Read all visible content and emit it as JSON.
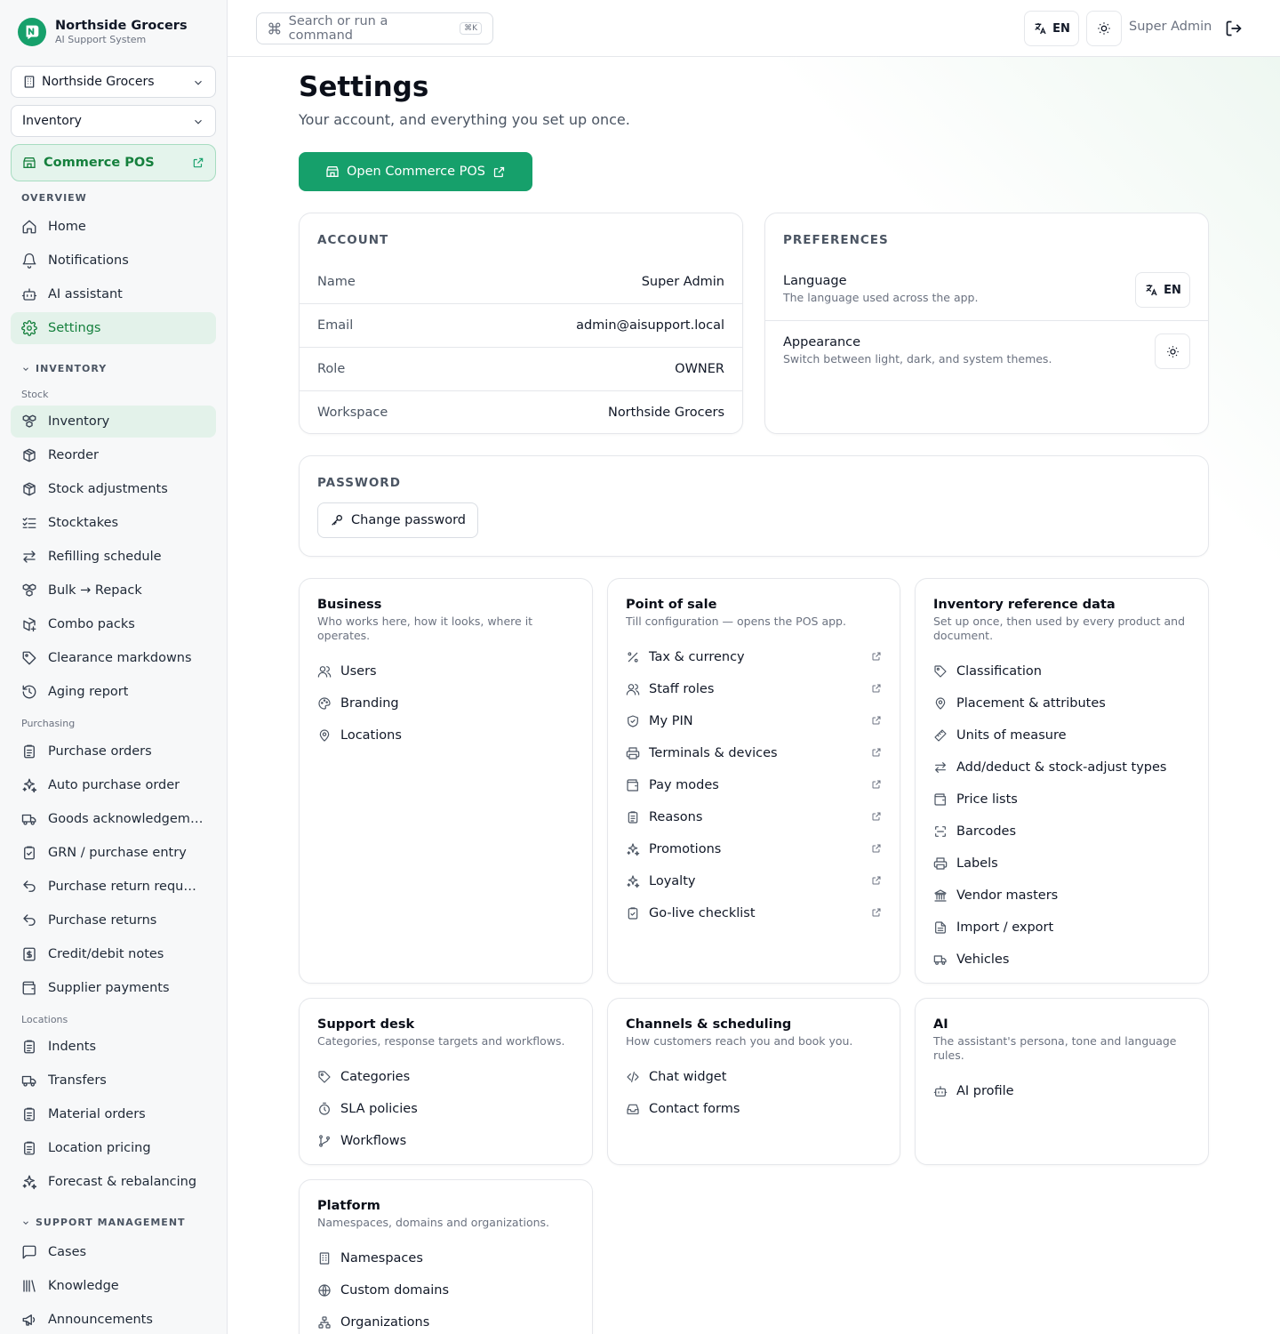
{
  "brand": {
    "name": "Northside Grocers",
    "subtitle": "AI Support System"
  },
  "sidebar": {
    "workspace_select": "Northside Grocers",
    "module_select": "Inventory",
    "pos_button": "Commerce POS",
    "overview_title": "OVERVIEW",
    "overview": [
      {
        "label": "Home",
        "icon": "home-icon"
      },
      {
        "label": "Notifications",
        "icon": "bell-icon"
      },
      {
        "label": "AI assistant",
        "icon": "bot-icon"
      },
      {
        "label": "Settings",
        "icon": "gear-icon",
        "active": true
      }
    ],
    "inventory_title": "INVENTORY",
    "stock_label": "Stock",
    "stock": [
      {
        "label": "Inventory",
        "icon": "boxes-icon",
        "active": true
      },
      {
        "label": "Reorder",
        "icon": "package-icon"
      },
      {
        "label": "Stock adjustments",
        "icon": "package-icon"
      },
      {
        "label": "Stocktakes",
        "icon": "list-check-icon"
      },
      {
        "label": "Refilling schedule",
        "icon": "arrows-icon"
      },
      {
        "label": "Bulk → Repack",
        "icon": "boxes-icon"
      },
      {
        "label": "Combo packs",
        "icon": "package-plus-icon"
      },
      {
        "label": "Clearance markdowns",
        "icon": "tag-icon"
      },
      {
        "label": "Aging report",
        "icon": "history-icon"
      }
    ],
    "purchasing_label": "Purchasing",
    "purchasing": [
      {
        "label": "Purchase orders",
        "icon": "clipboard-icon"
      },
      {
        "label": "Auto purchase order",
        "icon": "sparkles-icon"
      },
      {
        "label": "Goods acknowledgement",
        "icon": "truck-icon"
      },
      {
        "label": "GRN / purchase entry",
        "icon": "clipboard-check-icon"
      },
      {
        "label": "Purchase return requests",
        "icon": "undo-icon"
      },
      {
        "label": "Purchase returns",
        "icon": "undo-icon"
      },
      {
        "label": "Credit/debit notes",
        "icon": "receipt-icon"
      },
      {
        "label": "Supplier payments",
        "icon": "wallet-icon"
      }
    ],
    "locations_label": "Locations",
    "locations": [
      {
        "label": "Indents",
        "icon": "clipboard-icon"
      },
      {
        "label": "Transfers",
        "icon": "truck-icon"
      },
      {
        "label": "Material orders",
        "icon": "clipboard-icon"
      },
      {
        "label": "Location pricing",
        "icon": "clipboard-icon"
      },
      {
        "label": "Forecast & rebalancing",
        "icon": "sparkles-icon"
      }
    ],
    "support_title": "SUPPORT MANAGEMENT",
    "support": [
      {
        "label": "Cases",
        "icon": "message-square-icon"
      },
      {
        "label": "Knowledge",
        "icon": "library-icon"
      },
      {
        "label": "Announcements",
        "icon": "megaphone-icon"
      }
    ]
  },
  "topbar": {
    "search_placeholder": "Search or run a command",
    "search_kbd": "⌘K",
    "lang": "EN",
    "user": "Super Admin"
  },
  "main": {
    "title": "Settings",
    "subtitle": "Your account, and everything you set up once.",
    "open_pos": "Open Commerce POS",
    "account": {
      "title": "ACCOUNT",
      "rows": [
        {
          "k": "Name",
          "v": "Super Admin"
        },
        {
          "k": "Email",
          "v": "admin@aisupport.local"
        },
        {
          "k": "Role",
          "v": "OWNER"
        },
        {
          "k": "Workspace",
          "v": "Northside Grocers"
        }
      ]
    },
    "preferences": {
      "title": "PREFERENCES",
      "language": {
        "t": "Language",
        "d": "The language used across the app.",
        "btn": "EN"
      },
      "appearance": {
        "t": "Appearance",
        "d": "Switch between light, dark, and system themes."
      }
    },
    "password": {
      "title": "PASSWORD",
      "btn": "Change password"
    },
    "groups": {
      "business": {
        "title": "Business",
        "desc": "Who works here, how it looks, where it operates.",
        "items": [
          {
            "label": "Users",
            "icon": "users-icon"
          },
          {
            "label": "Branding",
            "icon": "palette-icon"
          },
          {
            "label": "Locations",
            "icon": "map-pin-icon"
          }
        ]
      },
      "pos": {
        "title": "Point of sale",
        "desc": "Till configuration — opens the POS app.",
        "items": [
          {
            "label": "Tax & currency",
            "icon": "percent-icon"
          },
          {
            "label": "Staff roles",
            "icon": "users-icon"
          },
          {
            "label": "My PIN",
            "icon": "shield-icon"
          },
          {
            "label": "Terminals & devices",
            "icon": "printer-icon"
          },
          {
            "label": "Pay modes",
            "icon": "wallet-icon"
          },
          {
            "label": "Reasons",
            "icon": "clipboard-icon"
          },
          {
            "label": "Promotions",
            "icon": "sparkles-icon"
          },
          {
            "label": "Loyalty",
            "icon": "sparkles-icon"
          },
          {
            "label": "Go-live checklist",
            "icon": "clipboard-check-icon"
          }
        ]
      },
      "invref": {
        "title": "Inventory reference data",
        "desc": "Set up once, then used by every product and document.",
        "items": [
          {
            "label": "Classification",
            "icon": "tag-icon"
          },
          {
            "label": "Placement & attributes",
            "icon": "map-pin-icon"
          },
          {
            "label": "Units of measure",
            "icon": "ruler-icon"
          },
          {
            "label": "Add/deduct & stock-adjust types",
            "icon": "arrows-icon"
          },
          {
            "label": "Price lists",
            "icon": "wallet-icon"
          },
          {
            "label": "Barcodes",
            "icon": "scan-icon"
          },
          {
            "label": "Labels",
            "icon": "printer-icon"
          },
          {
            "label": "Vendor masters",
            "icon": "landmark-icon"
          },
          {
            "label": "Import / export",
            "icon": "file-icon"
          },
          {
            "label": "Vehicles",
            "icon": "truck-icon"
          }
        ]
      },
      "support": {
        "title": "Support desk",
        "desc": "Categories, response targets and workflows.",
        "items": [
          {
            "label": "Categories",
            "icon": "tag-icon"
          },
          {
            "label": "SLA policies",
            "icon": "timer-icon"
          },
          {
            "label": "Workflows",
            "icon": "git-branch-icon"
          }
        ]
      },
      "channels": {
        "title": "Channels & scheduling",
        "desc": "How customers reach you and book you.",
        "items": [
          {
            "label": "Chat widget",
            "icon": "code-icon"
          },
          {
            "label": "Contact forms",
            "icon": "inbox-icon"
          }
        ]
      },
      "ai": {
        "title": "AI",
        "desc": "The assistant's persona, tone and language rules.",
        "items": [
          {
            "label": "AI profile",
            "icon": "bot-icon"
          }
        ]
      },
      "platform": {
        "title": "Platform",
        "desc": "Namespaces, domains and organizations.",
        "items": [
          {
            "label": "Namespaces",
            "icon": "building-icon"
          },
          {
            "label": "Custom domains",
            "icon": "globe-icon"
          },
          {
            "label": "Organizations",
            "icon": "network-icon"
          }
        ]
      }
    }
  }
}
